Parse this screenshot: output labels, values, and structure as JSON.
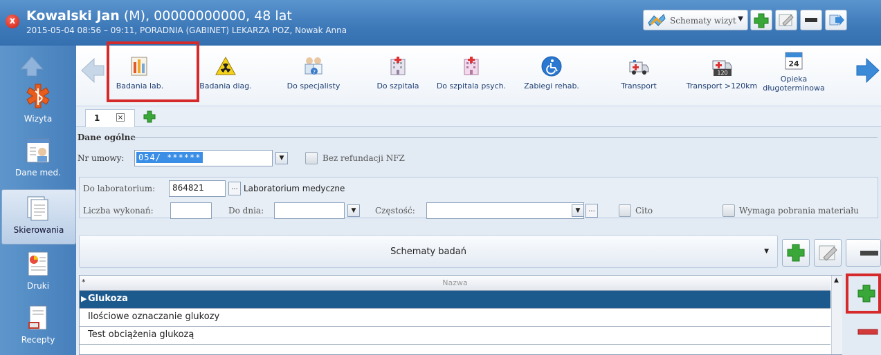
{
  "window": {
    "patient_name": "Kowalski Jan",
    "patient_rest": " (M), 00000000000, 48 lat",
    "subtitle": "2015-05-04 08:56 – 09:11, PORADNIA (GABINET) LEKARZA POZ, Nowak Anna",
    "close_glyph": "x",
    "visit_schemes_label": "Schematy wizyt"
  },
  "sidebar": {
    "items": [
      {
        "label": "Wizyta",
        "icon": "medical-star-icon"
      },
      {
        "label": "Dane med.",
        "icon": "patient-card-icon"
      },
      {
        "label": "Skierowania",
        "icon": "documents-icon",
        "selected": true
      },
      {
        "label": "Druki",
        "icon": "print-chart-icon"
      },
      {
        "label": "Recepty",
        "icon": "prescription-icon"
      }
    ]
  },
  "ribbon": {
    "items": [
      {
        "label": "Badania lab.",
        "icon": "lab-tests-icon",
        "highlighted": true
      },
      {
        "label": "Badania diag.",
        "icon": "radiation-warning-icon"
      },
      {
        "label": "Do specjalisty",
        "icon": "specialists-icon"
      },
      {
        "label": "Do szpitala",
        "icon": "hospital-icon"
      },
      {
        "label": "Do szpitala psych.",
        "icon": "psych-hospital-icon"
      },
      {
        "label": "Zabiegi rehab.",
        "icon": "wheelchair-icon"
      },
      {
        "label": "Transport",
        "icon": "ambulance-icon"
      },
      {
        "label": "Transport >120km",
        "icon": "ambulance-120-icon"
      },
      {
        "label": "Opieka długoterminowa",
        "icon": "calendar-24-icon",
        "calendar_number": "24"
      }
    ]
  },
  "tabs": {
    "active_label": "1",
    "close_glyph": "×"
  },
  "form": {
    "section_title": "Dane ogólne",
    "contract_label": "Nr umowy:",
    "contract_value": "054/ ******",
    "no_refund_label": "Bez refundacji NFZ",
    "lab_label": "Do laboratorium:",
    "lab_code": "864821",
    "lab_browse": "...",
    "lab_name": "Laboratorium medyczne",
    "count_label": "Liczba wykonań:",
    "until_label": "Do dnia:",
    "frequency_label": "Częstość:",
    "freq_browse": "...",
    "cito_label": "Cito",
    "material_label": "Wymaga pobrania materiału"
  },
  "schemes": {
    "label": "Schematy badań"
  },
  "grid": {
    "header_star": "*",
    "column_name": "Nazwa",
    "rows": [
      "Glukoza",
      "Ilościowe oznaczanie glukozy",
      "Test obciążenia glukozą"
    ]
  },
  "colors": {
    "title_bar": "#3d78b8",
    "highlight_red": "#d62a2a",
    "selected_row": "#1c5a8e",
    "add_green": "#3aa838",
    "remove_red": "#d43a3a"
  }
}
